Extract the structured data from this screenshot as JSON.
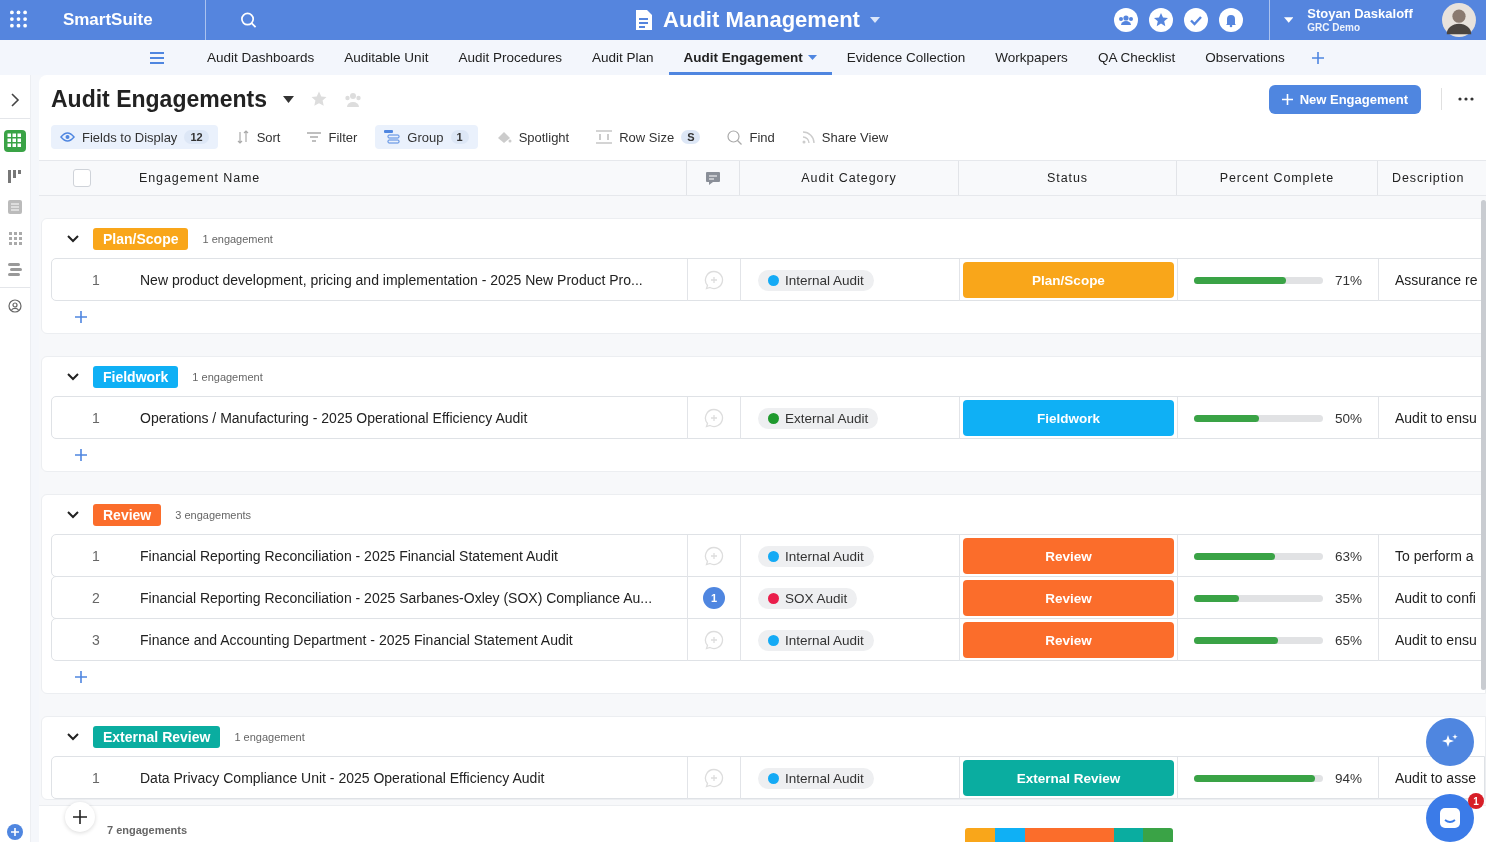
{
  "topbar": {
    "brand": "SmartSuite",
    "solution": "Audit Management",
    "user": {
      "name": "Stoyan Daskaloff",
      "workspace": "GRC Demo"
    }
  },
  "nav_tabs": [
    {
      "label": "Audit Dashboards",
      "selected": false
    },
    {
      "label": "Auditable Unit",
      "selected": false
    },
    {
      "label": "Audit Procedures",
      "selected": false
    },
    {
      "label": "Audit Plan",
      "selected": false
    },
    {
      "label": "Audit Engagement",
      "selected": true
    },
    {
      "label": "Evidence Collection",
      "selected": false
    },
    {
      "label": "Workpapers",
      "selected": false
    },
    {
      "label": "QA Checklist",
      "selected": false
    },
    {
      "label": "Observations",
      "selected": false
    }
  ],
  "view": {
    "title": "Audit Engagements",
    "new_button": "New Engagement"
  },
  "toolbar": [
    {
      "kind": "fields",
      "label": "Fields to Display",
      "badge": "12",
      "selected": true
    },
    {
      "kind": "sort",
      "label": "Sort",
      "selected": false
    },
    {
      "kind": "filter",
      "label": "Filter",
      "selected": false
    },
    {
      "kind": "group",
      "label": "Group",
      "badge": "1",
      "selected": true
    },
    {
      "kind": "spotlight",
      "label": "Spotlight",
      "selected": false
    },
    {
      "kind": "rowsize",
      "label": "Row Size",
      "badge": "S",
      "selected": false
    },
    {
      "kind": "find",
      "label": "Find",
      "selected": false
    },
    {
      "kind": "share",
      "label": "Share View",
      "selected": false
    }
  ],
  "table": {
    "select_all": {
      "checked": false
    },
    "columns": [
      "Engagement Name",
      "Audit Category",
      "Status",
      "Percent Complete",
      "Description"
    ],
    "groups": [
      {
        "label": "Plan/Scope",
        "color": "#f9a61a",
        "count": "1 engagement",
        "rows": [
          {
            "number": "1",
            "name": "New product development, pricing and implementation - 2025 New Product Pro...",
            "category": {
              "label": "Internal Audit",
              "color": "#14aaf5"
            },
            "status": "Plan/Scope",
            "level": 0.71,
            "percent": "71%",
            "description": "Assurance re"
          }
        ]
      },
      {
        "label": "Fieldwork",
        "color": "#0fb0f5",
        "count": "1 engagement",
        "rows": [
          {
            "number": "1",
            "name": "Operations / Manufacturing - 2025 Operational Efficiency Audit",
            "category": {
              "label": "External Audit",
              "color": "#1f9a2e"
            },
            "status": "Fieldwork",
            "level": 0.5,
            "percent": "50%",
            "description": "Audit to ensu"
          }
        ]
      },
      {
        "label": "Review",
        "color": "#fb6d2b",
        "count": "3 engagements",
        "rows": [
          {
            "number": "1",
            "name": "Financial Reporting Reconciliation - 2025 Financial Statement Audit",
            "category": {
              "label": "Internal Audit",
              "color": "#14aaf5"
            },
            "status": "Review",
            "level": 0.63,
            "percent": "63%",
            "description": "To perform a"
          },
          {
            "number": "2",
            "name": "Financial Reporting Reconciliation - 2025 Sarbanes-Oxley (SOX) Compliance Au...",
            "comments": "1",
            "category": {
              "label": "SOX Audit",
              "color": "#ea1e4b"
            },
            "status": "Review",
            "level": 0.35,
            "percent": "35%",
            "description": "Audit to confi"
          },
          {
            "number": "3",
            "name": "Finance and Accounting Department - 2025 Financial Statement Audit",
            "category": {
              "label": "Internal Audit",
              "color": "#14aaf5"
            },
            "status": "Review",
            "level": 0.65,
            "percent": "65%",
            "description": "Audit to ensu"
          }
        ]
      },
      {
        "label": "External Review",
        "color": "#0aada0",
        "count": "1 engagement",
        "rows": [
          {
            "number": "1",
            "name": "Data Privacy Compliance Unit - 2025 Operational Efficiency Audit",
            "category": {
              "label": "Internal Audit",
              "color": "#14aaf5"
            },
            "status": "External Review",
            "level": 0.94,
            "percent": "94%",
            "description": "Audit to asse"
          }
        ]
      }
    ]
  },
  "footer": {
    "total": "7 engagements",
    "status_summary": [
      {
        "color": "#f9a61a"
      },
      {
        "color": "#0fb0f5"
      },
      {
        "color": "#fb6d2b"
      },
      {
        "color": "#fb6d2b"
      },
      {
        "color": "#fb6d2b"
      },
      {
        "color": "#0aada0"
      },
      {
        "color": "#3aa346"
      }
    ]
  },
  "chat": {
    "badge": "1"
  }
}
